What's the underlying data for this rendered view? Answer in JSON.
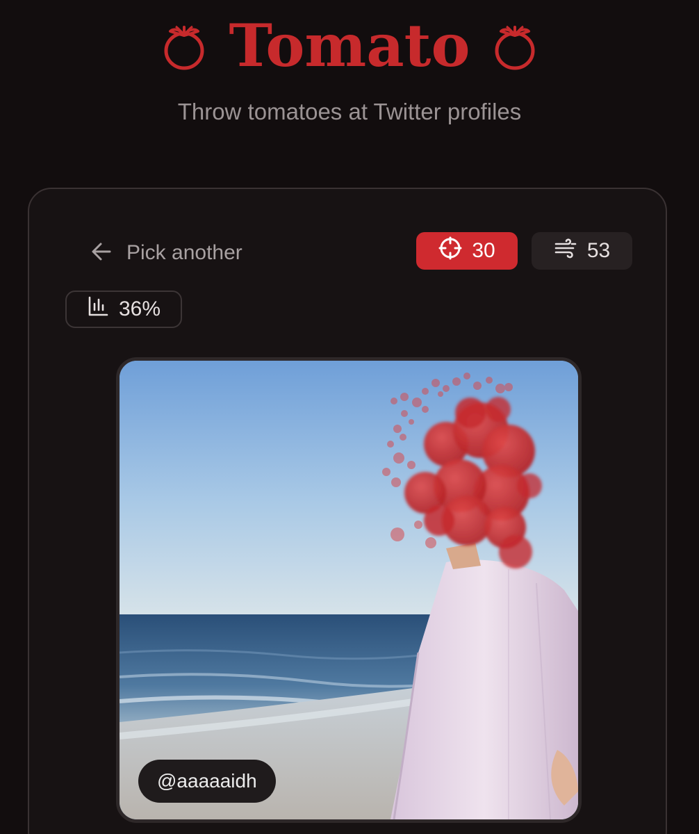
{
  "app": {
    "title": "Tomato",
    "tagline": "Throw tomatoes at Twitter profiles",
    "title_icon": "tomato-icon",
    "brand_color": "#c72a2c"
  },
  "toolbar": {
    "back_label": "Pick another",
    "back_icon": "arrow-left-icon",
    "hits": {
      "value": "30",
      "icon": "crosshair-icon"
    },
    "wind": {
      "value": "53",
      "icon": "wind-icon"
    },
    "coverage": {
      "value": "36%",
      "icon": "bar-chart-icon"
    }
  },
  "target": {
    "handle": "@aaaaaidh"
  }
}
